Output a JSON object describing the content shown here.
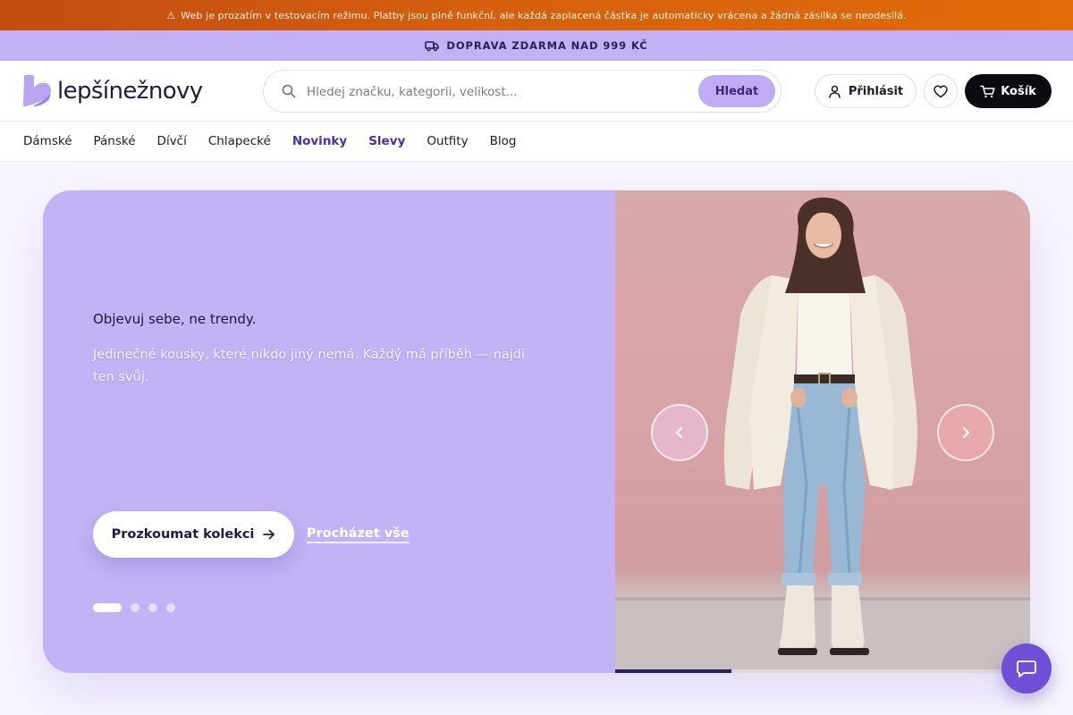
{
  "warning_bar": {
    "icon": "warning-icon",
    "text": "Web je prozatím v testovacím režimu. Platby jsou plně funkční, ale každá zaplacená částka je automaticky vrácena a žádná zásilka se neodesílá."
  },
  "shipping_bar": {
    "icon": "truck-icon",
    "text": "DOPRAVA ZDARMA NAD 999 KČ"
  },
  "header": {
    "logo_text": "lepšínežnovy",
    "search": {
      "placeholder": "Hledej značku, kategorii, velikost...",
      "value": "",
      "button_label": "Hledat"
    },
    "login_label": "Přihlásit",
    "cart_label": "Košík"
  },
  "nav": {
    "items": [
      {
        "label": "Dámské"
      },
      {
        "label": "Pánské"
      },
      {
        "label": "Dívčí"
      },
      {
        "label": "Chlapecké"
      },
      {
        "label": "Novinky",
        "accent": true
      },
      {
        "label": "Slevy",
        "accent": true
      },
      {
        "label": "Outfity"
      },
      {
        "label": "Blog"
      }
    ]
  },
  "hero": {
    "title": "Objevuj sebe, ne trendy.",
    "subtitle": "Jedinečné kousky, které nikdo jiný nemá. Každý má příběh — najdi ten svůj.",
    "primary_button": "Prozkoumat kolekci",
    "secondary_link": "Procházet vše",
    "slide_count": 4,
    "active_slide": 1,
    "progress": 0.28
  },
  "colors": {
    "warning_bg": "#d5600d",
    "shipping_bg": "#c2b1f5",
    "hero_bg": "#c3b2f5",
    "accent": "#4a2fa8",
    "search_button_bg": "#c0abf5",
    "cart_bg": "#0d0b12",
    "chat_bg": "#6e4fd6"
  }
}
